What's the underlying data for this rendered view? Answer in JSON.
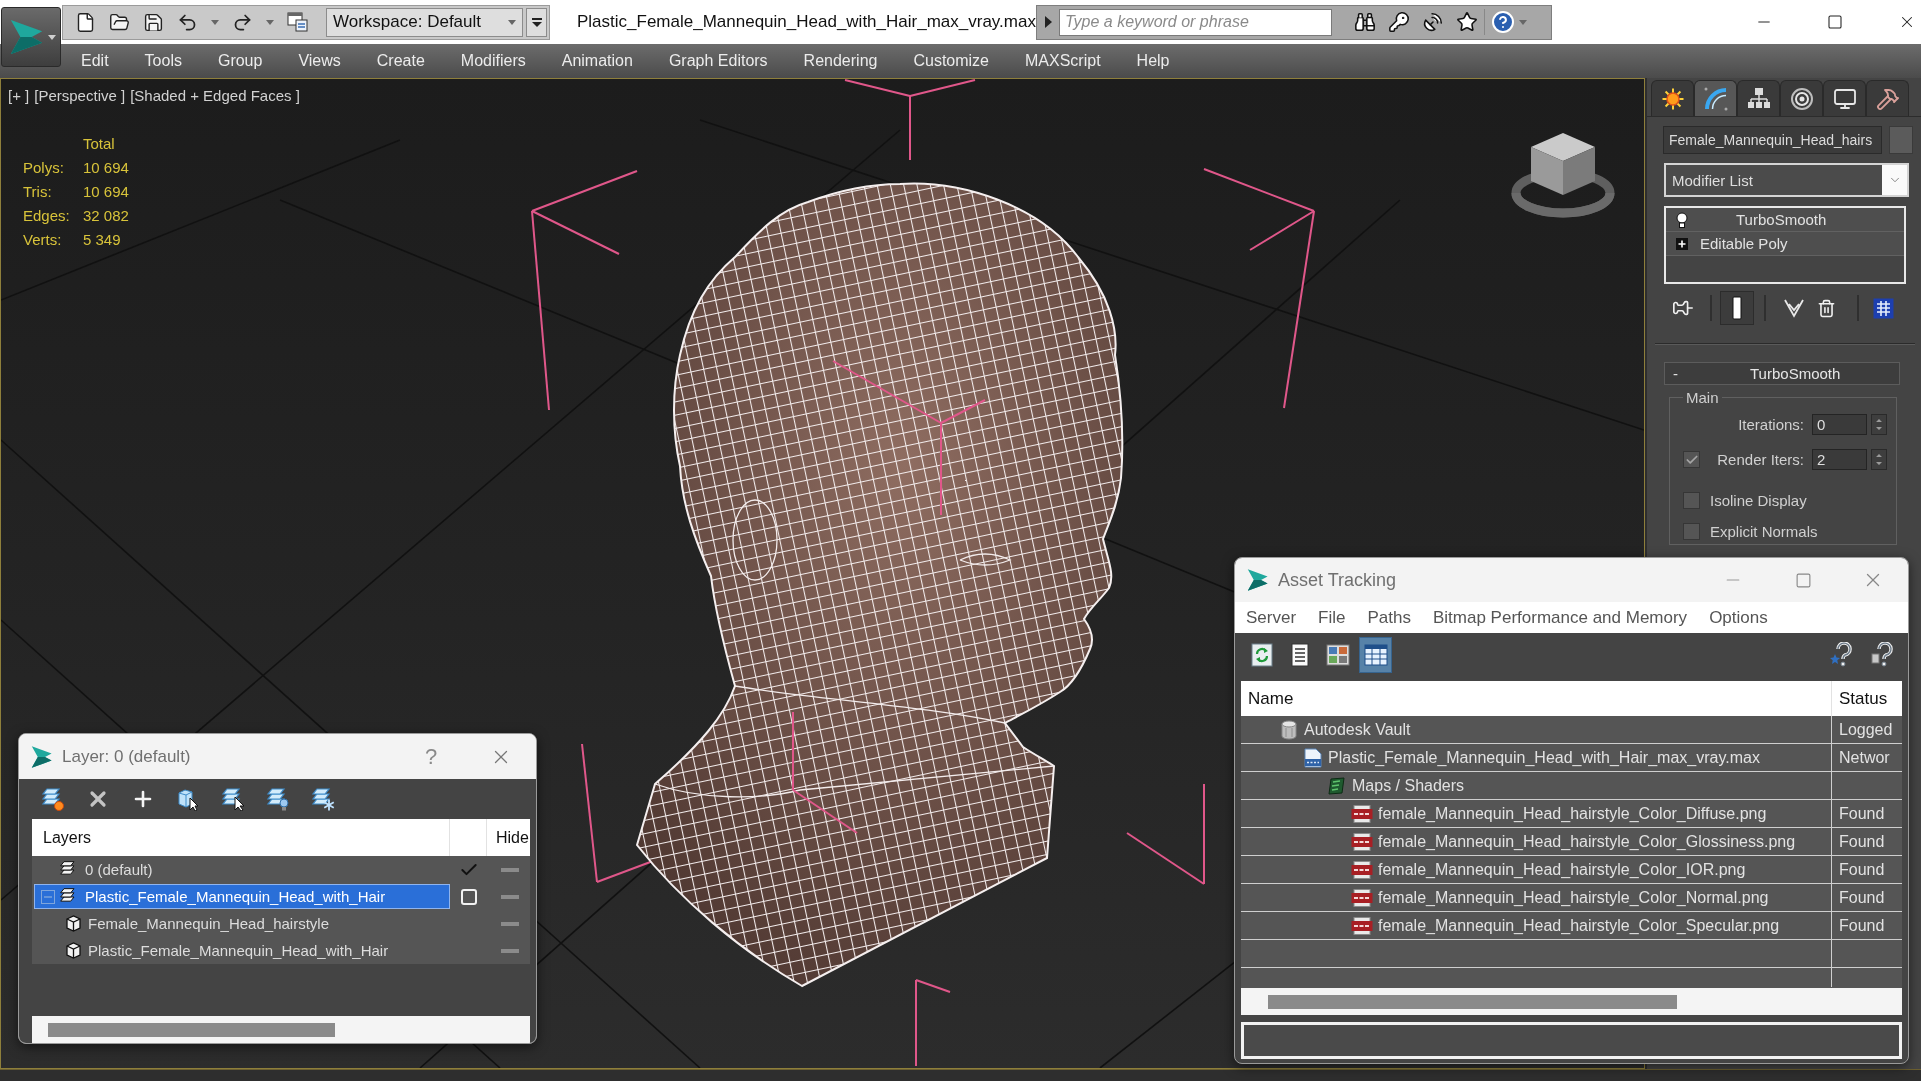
{
  "title_bar": {
    "workspace": "Workspace: Default",
    "title": "Plastic_Female_Mannequin_Head_with_Hair_max_vray.max",
    "search": {
      "placeholder": "Type a keyword or phrase"
    }
  },
  "menu_bar": [
    "Edit",
    "Tools",
    "Group",
    "Views",
    "Create",
    "Modifiers",
    "Animation",
    "Graph Editors",
    "Rendering",
    "Customize",
    "MAXScript",
    "Help"
  ],
  "viewport": {
    "labels": [
      "[+ ]",
      "[Perspective ]",
      "[Shaded + Edged Faces ]"
    ],
    "stats_header": "Total",
    "stats": [
      {
        "label": "Polys:",
        "value": "10 694"
      },
      {
        "label": "Tris:",
        "value": "10 694"
      },
      {
        "label": "Edges:",
        "value": "32 082"
      },
      {
        "label": "Verts:",
        "value": "5 349"
      }
    ]
  },
  "command_panel": {
    "tabs": [
      {
        "kind": "create",
        "selected": false
      },
      {
        "kind": "modify",
        "selected": true
      },
      {
        "kind": "hierarchy",
        "selected": false
      },
      {
        "kind": "motion",
        "selected": false
      },
      {
        "kind": "display",
        "selected": false
      },
      {
        "kind": "utilities",
        "selected": false
      }
    ],
    "object_name": "Female_Mannequin_Head_hairs",
    "modifier_list": "Modifier List",
    "stack": [
      {
        "kind": "modifier",
        "name": "TurboSmooth"
      },
      {
        "kind": "base_object",
        "name": "Editable Poly"
      }
    ],
    "rollout": {
      "toggle": "-",
      "title": "TurboSmooth",
      "group": "Main",
      "iterations": {
        "label": "Iterations:",
        "value": "0"
      },
      "render_iters": {
        "label": "Render Iters:",
        "value": "2",
        "checked": true
      },
      "checkboxes": [
        {
          "label": "Isoline Display",
          "checked": false
        },
        {
          "label": "Explicit Normals",
          "checked": false
        }
      ]
    }
  },
  "layer_dialog": {
    "title": "Layer: 0 (default)",
    "help": "?",
    "columns": [
      "Layers",
      "Hide"
    ],
    "rows": [
      {
        "kind": "layer",
        "name": "0 (default)",
        "current": true,
        "selected": false,
        "expanded": false,
        "hidden": false
      },
      {
        "kind": "layer",
        "name": "Plastic_Female_Mannequin_Head_with_Hair",
        "current": false,
        "selected": true,
        "expanded": true,
        "hidden": false,
        "children": [
          {
            "kind": "object",
            "name": "Female_Mannequin_Head_hairstyle",
            "selected": false,
            "hidden": false
          },
          {
            "kind": "object",
            "name": "Plastic_Female_Mannequin_Head_with_Hair",
            "selected": false,
            "hidden": false
          }
        ]
      }
    ]
  },
  "asset_tracking": {
    "title": "Asset Tracking",
    "menu": [
      "Server",
      "File",
      "Paths",
      "Bitmap Performance and Memory",
      "Options"
    ],
    "toolbar": [
      {
        "kind": "refresh",
        "selected": false
      },
      {
        "kind": "list",
        "selected": false
      },
      {
        "kind": "thumbnails",
        "selected": false
      },
      {
        "kind": "table",
        "selected": true
      }
    ],
    "columns": [
      "Name",
      "Status"
    ],
    "tree": [
      {
        "kind": "vault",
        "name": "Autodesk Vault",
        "status": "Logged",
        "children": [
          {
            "kind": "max",
            "name": "Plastic_Female_Mannequin_Head_with_Hair_max_vray.max",
            "status": "Networ",
            "children": [
              {
                "kind": "maps",
                "name": "Maps / Shaders",
                "children": [
                  {
                    "kind": "png",
                    "name": "female_Mannequin_Head_hairstyle_Color_Diffuse.png",
                    "status": "Found"
                  },
                  {
                    "kind": "png",
                    "name": "female_Mannequin_Head_hairstyle_Color_Glossiness.png",
                    "status": "Found"
                  },
                  {
                    "kind": "png",
                    "name": "female_Mannequin_Head_hairstyle_Color_IOR.png",
                    "status": "Found"
                  },
                  {
                    "kind": "png",
                    "name": "female_Mannequin_Head_hairstyle_Color_Normal.png",
                    "status": "Found"
                  },
                  {
                    "kind": "png",
                    "name": "female_Mannequin_Head_hairstyle_Color_Specular.png",
                    "status": "Found"
                  }
                ]
              }
            ]
          }
        ]
      }
    ]
  }
}
